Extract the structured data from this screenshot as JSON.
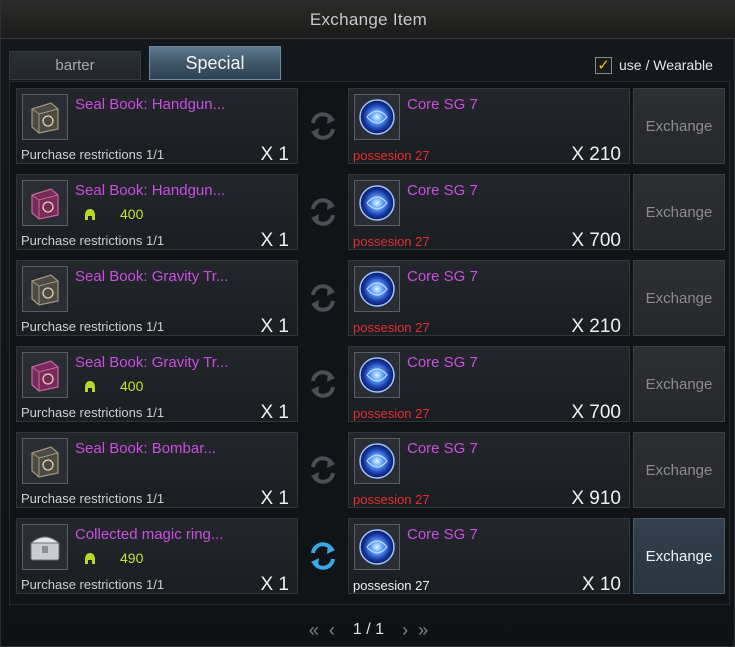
{
  "window": {
    "title": "Exchange Item"
  },
  "tabs": [
    {
      "label": "barter"
    },
    {
      "label": "Special"
    }
  ],
  "filter": {
    "label": "use / Wearable",
    "checked_mark": "✓"
  },
  "rows": [
    {
      "give": {
        "name": "Seal Book: Handgun...",
        "icon": "seal-book-dark-icon",
        "price": "",
        "restriction": "Purchase restrictions 1/1",
        "qty": "X 1"
      },
      "get": {
        "name": "Core SG 7",
        "icon": "core-orb-icon",
        "possession": "possesion 27",
        "qty": "X 210"
      },
      "exchange_label": "Exchange"
    },
    {
      "give": {
        "name": "Seal Book: Handgun...",
        "icon": "seal-book-purple-icon",
        "price": "400",
        "restriction": "Purchase restrictions 1/1",
        "qty": "X 1"
      },
      "get": {
        "name": "Core SG 7",
        "icon": "core-orb-icon",
        "possession": "possesion 27",
        "qty": "X 700"
      },
      "exchange_label": "Exchange"
    },
    {
      "give": {
        "name": "Seal Book: Gravity Tr...",
        "icon": "seal-book-dark-icon",
        "price": "",
        "restriction": "Purchase restrictions 1/1",
        "qty": "X 1"
      },
      "get": {
        "name": "Core SG 7",
        "icon": "core-orb-icon",
        "possession": "possesion 27",
        "qty": "X 210"
      },
      "exchange_label": "Exchange"
    },
    {
      "give": {
        "name": "Seal Book: Gravity Tr...",
        "icon": "seal-book-purple-icon",
        "price": "400",
        "restriction": "Purchase restrictions 1/1",
        "qty": "X 1"
      },
      "get": {
        "name": "Core SG 7",
        "icon": "core-orb-icon",
        "possession": "possesion 27",
        "qty": "X 700"
      },
      "exchange_label": "Exchange"
    },
    {
      "give": {
        "name": "Seal Book: Bombar...",
        "icon": "seal-book-dark-icon",
        "price": "",
        "restriction": "Purchase restrictions 1/1",
        "qty": "X 1"
      },
      "get": {
        "name": "Core SG 7",
        "icon": "core-orb-icon",
        "possession": "possesion 27",
        "qty": "X 910"
      },
      "exchange_label": "Exchange"
    },
    {
      "give": {
        "name": "Collected magic ring...",
        "icon": "treasure-chest-icon",
        "price": "490",
        "restriction": "Purchase restrictions 1/1",
        "qty": "X 1"
      },
      "get": {
        "name": "Core SG 7",
        "icon": "core-orb-icon",
        "possession": "possesion 27",
        "qty": "X 10"
      },
      "exchange_label": "Exchange"
    }
  ],
  "pager": {
    "first": "«",
    "prev": "‹",
    "page": "1 / 1",
    "next": "›",
    "last": "»"
  },
  "colors": {
    "item_name": "#c84fe0",
    "price": "#c8e03a",
    "possession_insufficient": "#e03030",
    "possession_ok": "#f0f0f0",
    "swap_active": "#3aa8e8",
    "swap_inactive": "#4a4f56"
  }
}
